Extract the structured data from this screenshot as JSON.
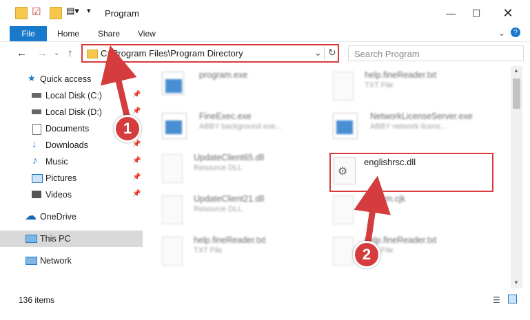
{
  "window": {
    "title": "Program"
  },
  "ribbon": {
    "file": "File",
    "tabs": [
      "Home",
      "Share",
      "View"
    ]
  },
  "address": {
    "path": "C:\\Program Files\\Program Directory",
    "search_placeholder": "Search Program"
  },
  "sidebar": {
    "items": [
      {
        "label": "Quick access",
        "icon": "star-icon"
      },
      {
        "label": "Local Disk (C:)",
        "icon": "drive-icon"
      },
      {
        "label": "Local Disk (D:)",
        "icon": "drive-icon"
      },
      {
        "label": "Documents",
        "icon": "documents-icon"
      },
      {
        "label": "Downloads",
        "icon": "downloads-icon"
      },
      {
        "label": "Music",
        "icon": "music-icon"
      },
      {
        "label": "Pictures",
        "icon": "pictures-icon"
      },
      {
        "label": "Videos",
        "icon": "videos-icon"
      },
      {
        "label": "OneDrive",
        "icon": "cloud-icon"
      },
      {
        "label": "This PC",
        "icon": "pc-icon"
      },
      {
        "label": "Network",
        "icon": "network-icon"
      }
    ]
  },
  "files": [
    {
      "name": "program.exe",
      "type": ""
    },
    {
      "name": "help.fineReader.txt",
      "type": "TXT File"
    },
    {
      "name": "FineExec.exe",
      "type": "ABBY background exe..."
    },
    {
      "name": "NetworkLicenseServer.exe",
      "type": "ABBY network licens..."
    },
    {
      "name": "UpdateClient65.dll",
      "type": "Resource DLL"
    },
    {
      "name": "englishrsc.dll",
      "type": ""
    },
    {
      "name": "UpdateClient21.dll",
      "type": "Resource DLL"
    },
    {
      "name": "BitKom.cjk",
      "type": "File"
    },
    {
      "name": "help.fineReader.txt",
      "type": "TXT File"
    },
    {
      "name": "help.fineReader.txt",
      "type": "TXT File"
    }
  ],
  "status": {
    "count": "136 items"
  },
  "annotations": {
    "step1": "1",
    "step2": "2"
  },
  "colors": {
    "accent": "#1979ca",
    "highlight": "#d9393b"
  }
}
